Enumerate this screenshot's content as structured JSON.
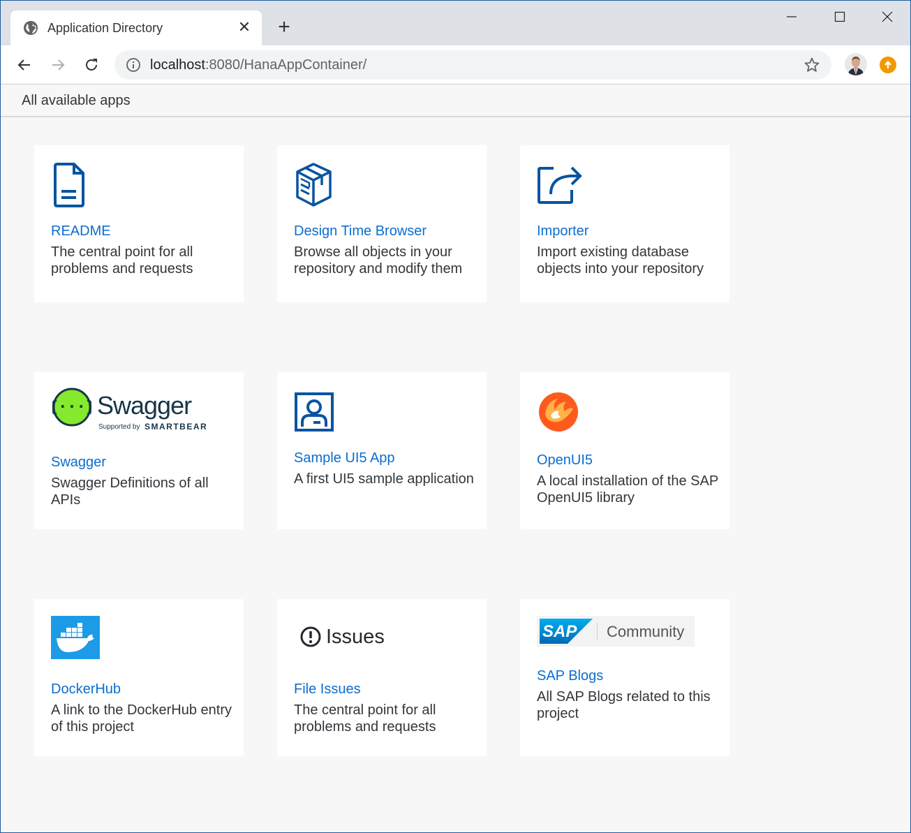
{
  "browser": {
    "tab_title": "Application Directory",
    "tab_close": "✕",
    "new_tab": "+",
    "url_host": "localhost",
    "url_rest": ":8080/HanaAppContainer/"
  },
  "page": {
    "heading": "All available apps"
  },
  "tiles": [
    {
      "title": "README",
      "description": "The central point for all problems and requests",
      "icon": "document-icon"
    },
    {
      "title": "Design Time Browser",
      "description": "Browse all objects in your repository and modify them",
      "icon": "package-icon"
    },
    {
      "title": "Importer",
      "description": "Import existing database objects into your repository",
      "icon": "share-icon"
    },
    {
      "title": "Swagger",
      "description": "Swagger Definitions of all APIs",
      "icon": "swagger-logo",
      "logo_text": "Swagger",
      "logo_sub1": "Supported by",
      "logo_sub2": "SMARTBEAR"
    },
    {
      "title": "Sample UI5 App",
      "description": "A first UI5 sample application",
      "icon": "person-card-icon"
    },
    {
      "title": "OpenUI5",
      "description": "A local installation of the SAP OpenUI5 library",
      "icon": "openui5-logo"
    },
    {
      "title": "DockerHub",
      "description": "A link to the DockerHub entry of this project",
      "icon": "docker-logo"
    },
    {
      "title": "File Issues",
      "description": "The central point for all problems and requests",
      "icon": "issues-logo",
      "logo_text": "Issues"
    },
    {
      "title": "SAP Blogs",
      "description": "All SAP Blogs related to this project",
      "icon": "sap-community-logo",
      "logo_sap": "SAP",
      "logo_text": "Community"
    }
  ],
  "colors": {
    "link": "#0a6ed1",
    "icon_blue": "#0854a0",
    "text": "#32363a",
    "page_bg": "#f7f7f7",
    "swagger_green": "#85ea2d",
    "docker_blue": "#1d9be6",
    "sap_blue": "#0a7fc2"
  }
}
